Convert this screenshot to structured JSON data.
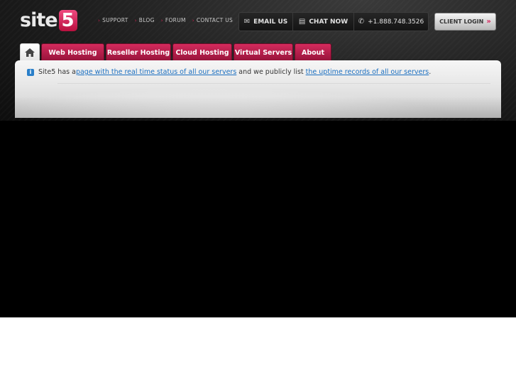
{
  "logo": {
    "text": "site",
    "number": "5"
  },
  "top_links": [
    "SUPPORT",
    "BLOG",
    "FORUM",
    "CONTACT US"
  ],
  "contact": {
    "email_label": "EMAIL US",
    "chat_label": "CHAT NOW",
    "phone": "+1.888.748.3526"
  },
  "client_login": {
    "label": "CLIENT LOGIN",
    "chevrons": "»"
  },
  "tabs": [
    "Web Hosting",
    "Reseller Hosting",
    "Cloud Hosting",
    "Virtual Servers",
    "About"
  ],
  "notice": {
    "prefix": "Site5 has a ",
    "link1": "page with the real time status of all our servers",
    "middle": " and we publicly list ",
    "link2": "the uptime records of all our servers",
    "suffix": "."
  },
  "icons": {
    "home": "home-icon",
    "email": "envelope-icon",
    "chat": "chat-bubble-icon",
    "phone": "phone-icon",
    "info": "info-icon"
  },
  "colors": {
    "accent": "#c21f4f",
    "link": "#1b6fc0",
    "background": "#000000"
  }
}
